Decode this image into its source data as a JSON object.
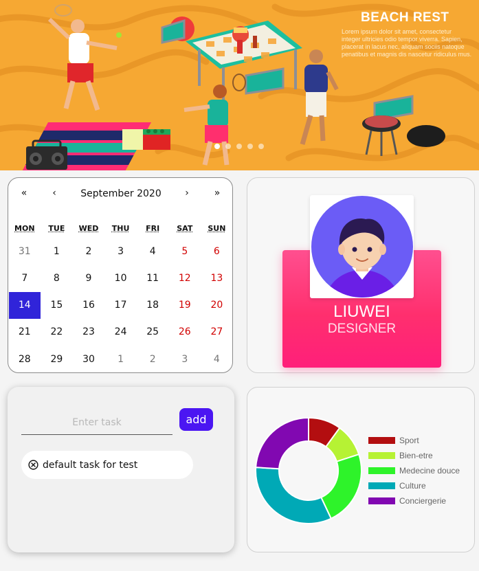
{
  "banner": {
    "title": "BEACH REST",
    "body_text": "Lorem ipsum dolor sit amet, consectetur integer ultricies odio tempor viverra. Sapien, placerat in lacus nec, aliquam sociis natoque penatibus et magnis dis nascetur ridiculus mus.",
    "slides": 5,
    "active_slide": 1
  },
  "calendar": {
    "month_label": "September 2020",
    "nav": {
      "prev_year": "«",
      "prev_month": "‹",
      "next_month": "›",
      "next_year": "»"
    },
    "weekdays": [
      "MON",
      "TUE",
      "WED",
      "THU",
      "FRI",
      "SAT",
      "SUN"
    ],
    "weeks": [
      [
        "31",
        "1",
        "2",
        "3",
        "4",
        "5",
        "6"
      ],
      [
        "7",
        "8",
        "9",
        "10",
        "11",
        "12",
        "13"
      ],
      [
        "14",
        "15",
        "16",
        "17",
        "18",
        "19",
        "20"
      ],
      [
        "21",
        "22",
        "23",
        "24",
        "25",
        "26",
        "27"
      ],
      [
        "28",
        "29",
        "30",
        "1",
        "2",
        "3",
        "4"
      ]
    ],
    "selected_day": "14"
  },
  "profile": {
    "name": "LIUWEI",
    "role": "DESIGNER",
    "card_color": "#ff2f6e",
    "avatar_bg": "#6b5cf6"
  },
  "tasks": {
    "input_placeholder": "Enter task",
    "input_value": "",
    "add_label": "add",
    "items": [
      {
        "label": "default task for test",
        "icon": "close-circle-icon"
      }
    ]
  },
  "chart_data": {
    "type": "pie",
    "variant": "doughnut",
    "labels": [
      "Sport",
      "Bien-etre",
      "Medecine douce",
      "Culture",
      "Conciergerie"
    ],
    "values": [
      10,
      10,
      23,
      33,
      24
    ],
    "colors": [
      "#b30e10",
      "#b6f234",
      "#2ef32a",
      "#00a9b6",
      "#8108b1"
    ],
    "legend_position": "right"
  }
}
